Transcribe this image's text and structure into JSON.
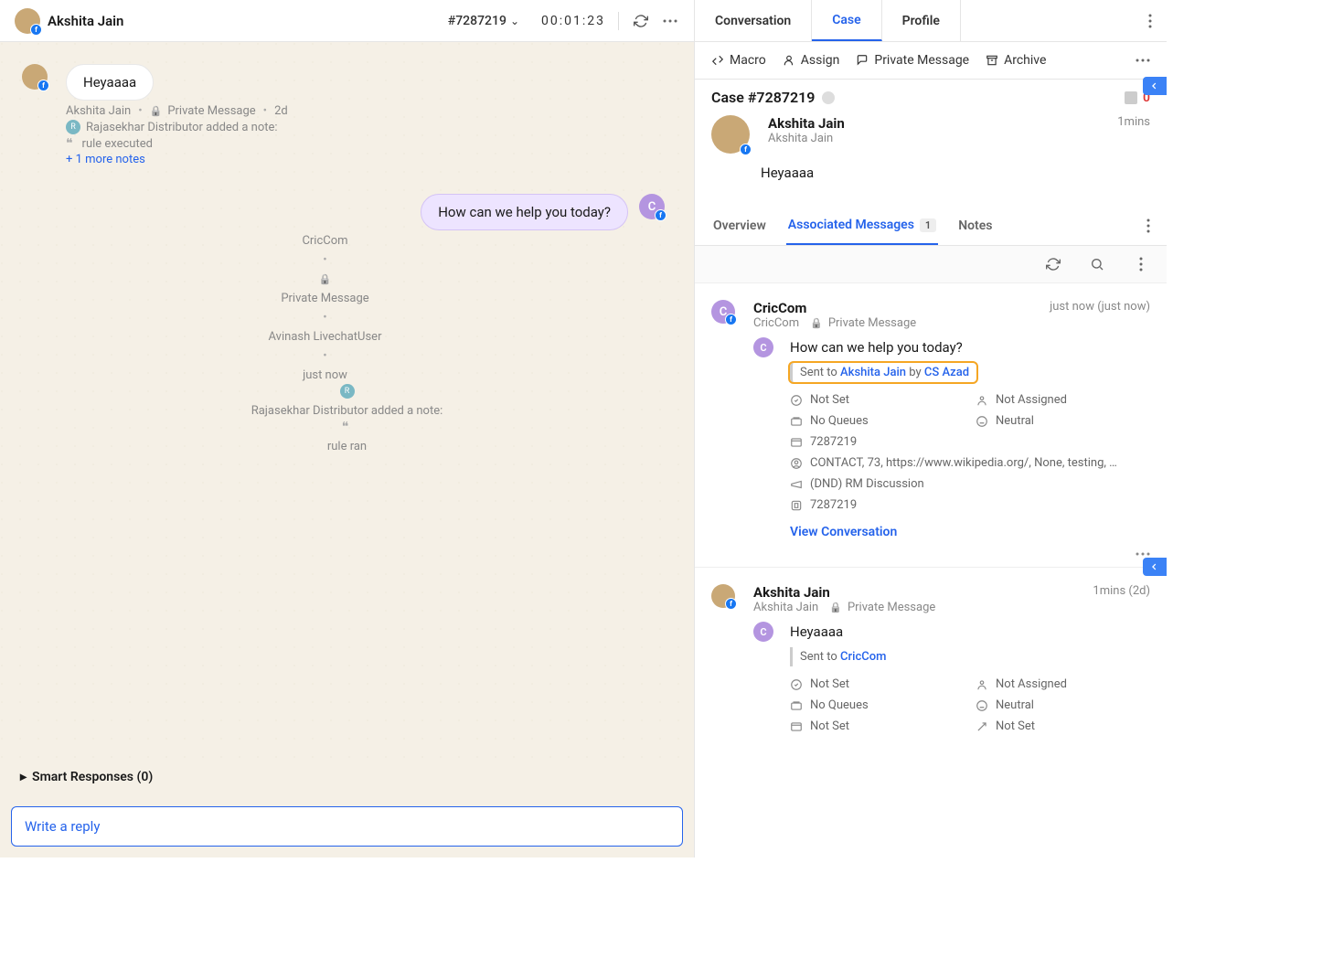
{
  "header": {
    "customer_name": "Akshita Jain",
    "case_id": "#7287219",
    "timer": "00:01:23"
  },
  "chat": {
    "incoming": {
      "text": "Heyaaaa",
      "author": "Akshita Jain",
      "channel": "Private Message",
      "age": "2d",
      "note_author": "Rajasekhar Distributor added a note:",
      "note_text": "rule executed",
      "more_notes": "+ 1 more notes"
    },
    "outgoing": {
      "text": "How can we help you today?",
      "brand": "CricCom",
      "channel": "Private Message",
      "agent": "Avinash LivechatUser",
      "age": "just now",
      "note_author": "Rajasekhar Distributor added a note:",
      "note_text": "rule ran"
    },
    "smart_responses": "Smart Responses (0)",
    "reply_placeholder": "Write a reply"
  },
  "right": {
    "tabs": {
      "conversation": "Conversation",
      "case": "Case",
      "profile": "Profile"
    },
    "actions": {
      "macro": "Macro",
      "assign": "Assign",
      "private_message": "Private Message",
      "archive": "Archive"
    },
    "case_title": "Case #7287219",
    "alert_count": "0",
    "person": {
      "name": "Akshita Jain",
      "sub": "Akshita Jain",
      "time": "1mins",
      "msg": "Heyaaaa"
    },
    "subtabs": {
      "overview": "Overview",
      "assoc": "Associated Messages",
      "assoc_count": "1",
      "notes": "Notes"
    },
    "assoc1": {
      "name": "CricCom",
      "sub_brand": "CricCom",
      "channel": "Private Message",
      "time": "just now (just now)",
      "avatar_letter": "C",
      "msg": "How can we help you today?",
      "sent_prefix": "Sent to ",
      "sent_to": "Akshita Jain",
      "by": " by ",
      "by_user": "CS Azad",
      "status": "Not Set",
      "assigned": "Not Assigned",
      "queues": "No Queues",
      "sentiment": "Neutral",
      "caseid": "7287219",
      "contact": "CONTACT, 73, https://www.wikipedia.org/, None, testing, …",
      "campaign": "(DND) RM Discussion",
      "caseid2": "7287219",
      "view": "View Conversation"
    },
    "assoc2": {
      "name": "Akshita Jain",
      "sub": "Akshita Jain",
      "channel": "Private Message",
      "time": "1mins (2d)",
      "avatar_letter": "C",
      "msg": "Heyaaaa",
      "sent_prefix": "Sent to ",
      "sent_to": "CricCom",
      "status": "Not Set",
      "assigned": "Not Assigned",
      "queues": "No Queues",
      "sentiment": "Neutral",
      "f1": "Not Set",
      "f2": "Not Set"
    }
  }
}
